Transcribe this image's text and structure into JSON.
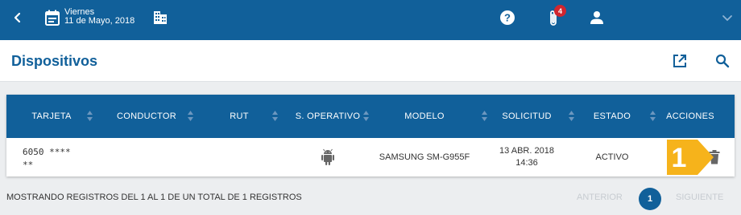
{
  "header": {
    "date_day": "Viernes",
    "date_full": "11 de Mayo, 2018",
    "notifications_count": "4",
    "back_icon": "chevron-left-icon",
    "calendar_icon": "calendar-icon",
    "building_icon": "building-icon",
    "help_icon": "help-circle-icon",
    "attachment_icon": "paperclip-icon",
    "user_icon": "person-icon",
    "menu_icon": "chevron-down-icon"
  },
  "page": {
    "title": "Dispositivos",
    "open_external_icon": "open-in-new-icon",
    "search_icon": "search-icon"
  },
  "table": {
    "columns": [
      "TARJETA",
      "CONDUCTOR",
      "RUT",
      "S. OPERATIVO",
      "MODELO",
      "SOLICITUD",
      "ESTADO",
      "ACCIONES"
    ],
    "rows": [
      {
        "tarjeta_line1": "6050 ****",
        "tarjeta_line2": "**",
        "conductor": "",
        "rut": "",
        "os_icon": "android-icon",
        "modelo": "SAMSUNG SM-G955F",
        "solicitud_date": "13 ABR. 2018",
        "solicitud_time": "14:36",
        "estado": "ACTIVO",
        "action_icon": "trash-icon"
      }
    ]
  },
  "pagination": {
    "summary": "MOSTRANDO REGISTROS DEL 1 AL 1 DE UN TOTAL DE 1 REGISTROS",
    "previous": "ANTERIOR",
    "current_page": "1",
    "next": "SIGUIENTE"
  },
  "callout": {
    "number": "1",
    "color": "#f6b31b"
  },
  "colors": {
    "primary": "#11609a",
    "badge": "#d0262f",
    "background": "#eceef0"
  }
}
